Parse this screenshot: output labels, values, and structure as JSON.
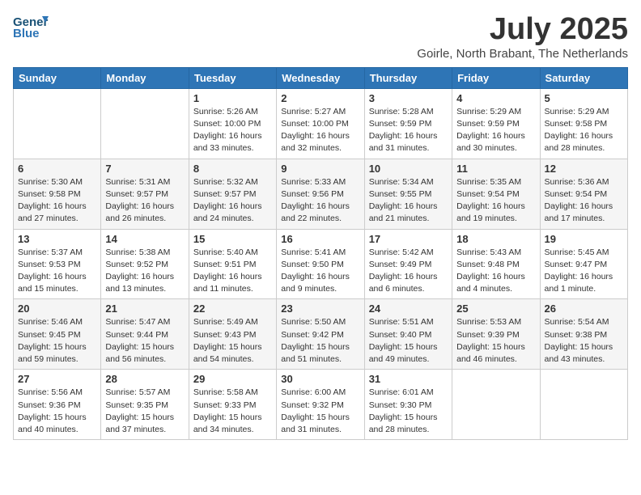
{
  "header": {
    "logo_text_general": "General",
    "logo_text_blue": "Blue",
    "month_title": "July 2025",
    "subtitle": "Goirle, North Brabant, The Netherlands"
  },
  "weekdays": [
    "Sunday",
    "Monday",
    "Tuesday",
    "Wednesday",
    "Thursday",
    "Friday",
    "Saturday"
  ],
  "weeks": [
    [
      {
        "day": "",
        "info": ""
      },
      {
        "day": "",
        "info": ""
      },
      {
        "day": "1",
        "info": "Sunrise: 5:26 AM\nSunset: 10:00 PM\nDaylight: 16 hours and 33 minutes."
      },
      {
        "day": "2",
        "info": "Sunrise: 5:27 AM\nSunset: 10:00 PM\nDaylight: 16 hours and 32 minutes."
      },
      {
        "day": "3",
        "info": "Sunrise: 5:28 AM\nSunset: 9:59 PM\nDaylight: 16 hours and 31 minutes."
      },
      {
        "day": "4",
        "info": "Sunrise: 5:29 AM\nSunset: 9:59 PM\nDaylight: 16 hours and 30 minutes."
      },
      {
        "day": "5",
        "info": "Sunrise: 5:29 AM\nSunset: 9:58 PM\nDaylight: 16 hours and 28 minutes."
      }
    ],
    [
      {
        "day": "6",
        "info": "Sunrise: 5:30 AM\nSunset: 9:58 PM\nDaylight: 16 hours and 27 minutes."
      },
      {
        "day": "7",
        "info": "Sunrise: 5:31 AM\nSunset: 9:57 PM\nDaylight: 16 hours and 26 minutes."
      },
      {
        "day": "8",
        "info": "Sunrise: 5:32 AM\nSunset: 9:57 PM\nDaylight: 16 hours and 24 minutes."
      },
      {
        "day": "9",
        "info": "Sunrise: 5:33 AM\nSunset: 9:56 PM\nDaylight: 16 hours and 22 minutes."
      },
      {
        "day": "10",
        "info": "Sunrise: 5:34 AM\nSunset: 9:55 PM\nDaylight: 16 hours and 21 minutes."
      },
      {
        "day": "11",
        "info": "Sunrise: 5:35 AM\nSunset: 9:54 PM\nDaylight: 16 hours and 19 minutes."
      },
      {
        "day": "12",
        "info": "Sunrise: 5:36 AM\nSunset: 9:54 PM\nDaylight: 16 hours and 17 minutes."
      }
    ],
    [
      {
        "day": "13",
        "info": "Sunrise: 5:37 AM\nSunset: 9:53 PM\nDaylight: 16 hours and 15 minutes."
      },
      {
        "day": "14",
        "info": "Sunrise: 5:38 AM\nSunset: 9:52 PM\nDaylight: 16 hours and 13 minutes."
      },
      {
        "day": "15",
        "info": "Sunrise: 5:40 AM\nSunset: 9:51 PM\nDaylight: 16 hours and 11 minutes."
      },
      {
        "day": "16",
        "info": "Sunrise: 5:41 AM\nSunset: 9:50 PM\nDaylight: 16 hours and 9 minutes."
      },
      {
        "day": "17",
        "info": "Sunrise: 5:42 AM\nSunset: 9:49 PM\nDaylight: 16 hours and 6 minutes."
      },
      {
        "day": "18",
        "info": "Sunrise: 5:43 AM\nSunset: 9:48 PM\nDaylight: 16 hours and 4 minutes."
      },
      {
        "day": "19",
        "info": "Sunrise: 5:45 AM\nSunset: 9:47 PM\nDaylight: 16 hours and 1 minute."
      }
    ],
    [
      {
        "day": "20",
        "info": "Sunrise: 5:46 AM\nSunset: 9:45 PM\nDaylight: 15 hours and 59 minutes."
      },
      {
        "day": "21",
        "info": "Sunrise: 5:47 AM\nSunset: 9:44 PM\nDaylight: 15 hours and 56 minutes."
      },
      {
        "day": "22",
        "info": "Sunrise: 5:49 AM\nSunset: 9:43 PM\nDaylight: 15 hours and 54 minutes."
      },
      {
        "day": "23",
        "info": "Sunrise: 5:50 AM\nSunset: 9:42 PM\nDaylight: 15 hours and 51 minutes."
      },
      {
        "day": "24",
        "info": "Sunrise: 5:51 AM\nSunset: 9:40 PM\nDaylight: 15 hours and 49 minutes."
      },
      {
        "day": "25",
        "info": "Sunrise: 5:53 AM\nSunset: 9:39 PM\nDaylight: 15 hours and 46 minutes."
      },
      {
        "day": "26",
        "info": "Sunrise: 5:54 AM\nSunset: 9:38 PM\nDaylight: 15 hours and 43 minutes."
      }
    ],
    [
      {
        "day": "27",
        "info": "Sunrise: 5:56 AM\nSunset: 9:36 PM\nDaylight: 15 hours and 40 minutes."
      },
      {
        "day": "28",
        "info": "Sunrise: 5:57 AM\nSunset: 9:35 PM\nDaylight: 15 hours and 37 minutes."
      },
      {
        "day": "29",
        "info": "Sunrise: 5:58 AM\nSunset: 9:33 PM\nDaylight: 15 hours and 34 minutes."
      },
      {
        "day": "30",
        "info": "Sunrise: 6:00 AM\nSunset: 9:32 PM\nDaylight: 15 hours and 31 minutes."
      },
      {
        "day": "31",
        "info": "Sunrise: 6:01 AM\nSunset: 9:30 PM\nDaylight: 15 hours and 28 minutes."
      },
      {
        "day": "",
        "info": ""
      },
      {
        "day": "",
        "info": ""
      }
    ]
  ]
}
